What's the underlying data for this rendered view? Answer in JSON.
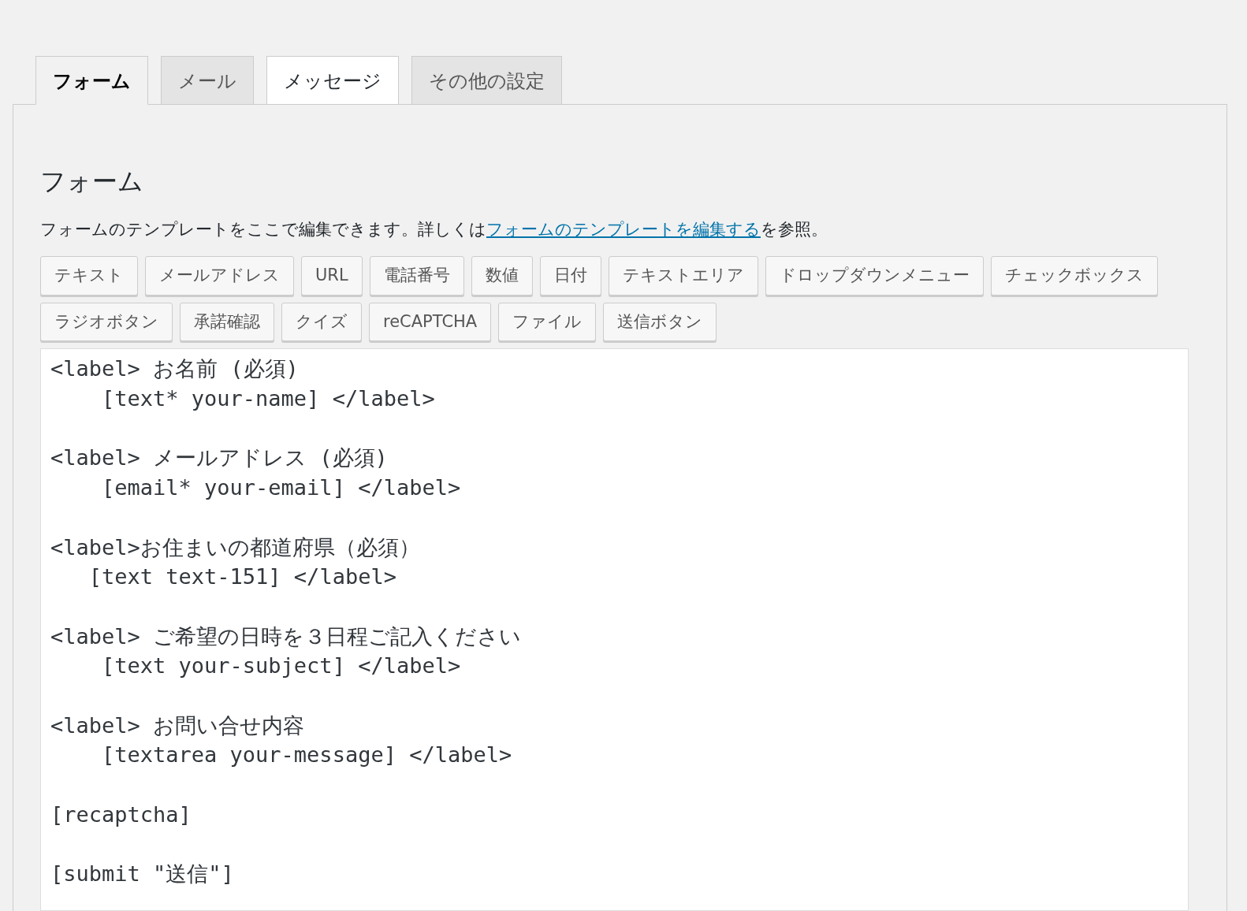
{
  "tabs": [
    {
      "label": "フォーム",
      "selected": true,
      "hovered": false
    },
    {
      "label": "メール",
      "selected": false,
      "hovered": false
    },
    {
      "label": "メッセージ",
      "selected": false,
      "hovered": true
    },
    {
      "label": "その他の設定",
      "selected": false,
      "hovered": false
    }
  ],
  "panel": {
    "title": "フォーム",
    "description": {
      "before": "フォームのテンプレートをここで編集できます。詳しくは",
      "link": "フォームのテンプレートを編集する",
      "after": "を参照。"
    },
    "tag_buttons": [
      [
        "テキスト",
        "メールアドレス",
        "URL",
        "電話番号",
        "数値",
        "日付",
        "テキストエリア",
        "ドロップダウンメニュー",
        "チェックボックス"
      ],
      [
        "ラジオボタン",
        "承諾確認",
        "クイズ",
        "reCAPTCHA",
        "ファイル",
        "送信ボタン"
      ]
    ],
    "template": [
      [
        "<label> お名前 (必須)",
        "    [text* your-name] </label>"
      ],
      [
        "<label> メールアドレス (必須)",
        "    [email* your-email] </label>"
      ],
      [
        "<label>お住まいの都道府県（必須）",
        "   [text text-151] </label>"
      ],
      [
        "<label> ご希望の日時を３日程ご記入ください",
        "    [text your-subject] </label>"
      ],
      [
        "<label> お問い合せ内容",
        "    [textarea your-message] </label>"
      ],
      [
        "[recaptcha]"
      ],
      [
        "[submit \"送信\"]"
      ]
    ]
  }
}
